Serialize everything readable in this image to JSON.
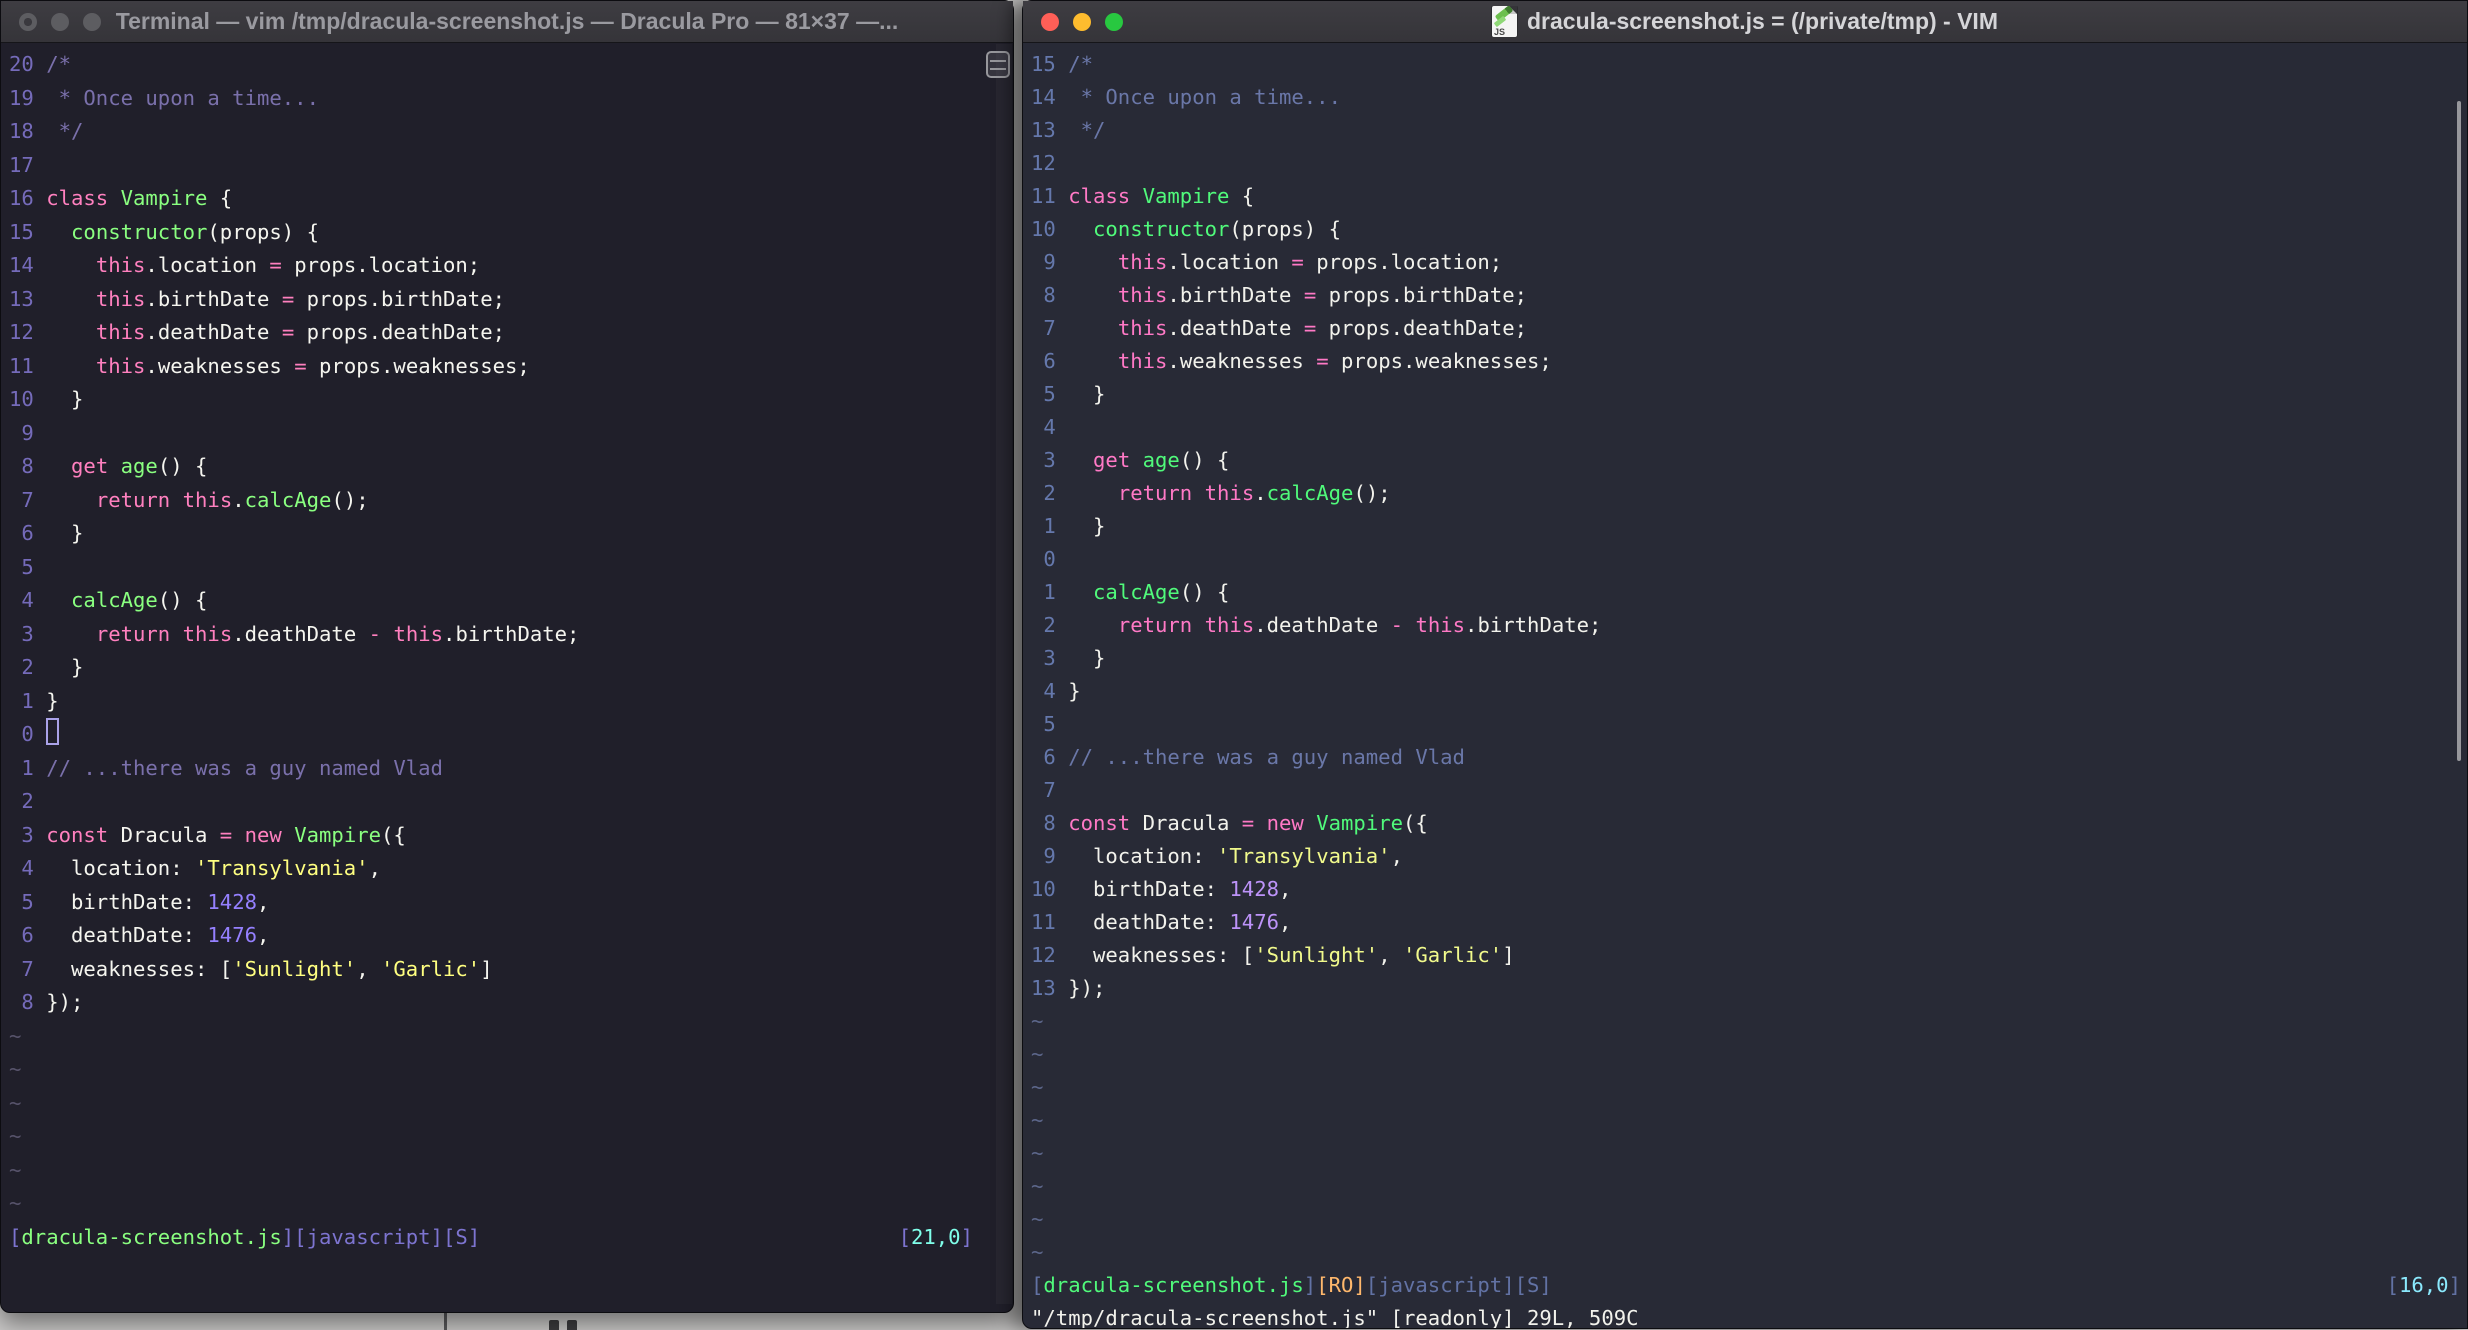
{
  "left_window": {
    "title": "Terminal — vim /tmp/dracula-screenshot.js — Dracula Pro — 81×37 —...",
    "numbers": [
      "20",
      "19",
      "18",
      "17",
      "16",
      "15",
      "14",
      "13",
      "12",
      "11",
      "10",
      "9",
      "8",
      "7",
      "6",
      "5",
      "4",
      "3",
      "2",
      "1",
      "0",
      "1",
      "2",
      "3",
      "4",
      "5",
      "6",
      "7",
      "8"
    ],
    "cursor_row": 20,
    "cursor_visible": true,
    "tilde_rows": 6,
    "statusline": [
      [
        "br",
        "["
      ],
      [
        "gr",
        "dracula-screenshot.js"
      ],
      [
        "br",
        "]["
      ],
      [
        "bl",
        "javascript"
      ],
      [
        "br",
        "]["
      ],
      [
        "bl",
        "S"
      ],
      [
        "br",
        "]"
      ]
    ],
    "ruler": [
      [
        "br",
        "["
      ],
      [
        "cy",
        "21,0"
      ],
      [
        "br",
        "]"
      ]
    ],
    "command_line": "",
    "palette": {
      "bg": "#201f2a",
      "fg": "#f5f5ef",
      "comment": "#7a70ab",
      "pink": "#ff80bf",
      "green": "#8aff80",
      "yellow": "#ffff80",
      "purple": "#9580ff",
      "cyan": "#80ffea",
      "orange": "#ffca80",
      "lnum": "#756bba",
      "bracket": "#7d74d0",
      "stat": "#7d74d0",
      "tilde": "#57536b"
    }
  },
  "right_window": {
    "title": "dracula-screenshot.js = (/private/tmp) - VIM",
    "file_icon": "js-file-icon",
    "numbers": [
      "15",
      "14",
      "13",
      "12",
      "11",
      "10",
      "9",
      "8",
      "7",
      "6",
      "5",
      "4",
      "3",
      "2",
      "1",
      "0",
      "1",
      "2",
      "3",
      "4",
      "5",
      "6",
      "7",
      "8",
      "9",
      "10",
      "11",
      "12",
      "13"
    ],
    "cursor_row": 15,
    "cursor_visible": false,
    "tilde_rows": 8,
    "statusline": [
      [
        "br",
        "["
      ],
      [
        "gr",
        "dracula-screenshot.js"
      ],
      [
        "br",
        "]"
      ],
      [
        "or",
        "[RO]"
      ],
      [
        "br",
        "["
      ],
      [
        "bl",
        "javascript"
      ],
      [
        "br",
        "]["
      ],
      [
        "bl",
        "S"
      ],
      [
        "br",
        "]"
      ]
    ],
    "ruler": [
      [
        "br",
        "["
      ],
      [
        "cy",
        "16,0"
      ],
      [
        "br",
        "]"
      ]
    ],
    "command_line": "\"/tmp/dracula-screenshot.js\" [readonly] 29L, 509C",
    "palette": {
      "bg": "#282a36",
      "fg": "#f2f2ec",
      "comment": "#6a77a8",
      "pink": "#ff79c6",
      "green": "#50fa7b",
      "yellow": "#f1fa8c",
      "purple": "#bd93f9",
      "cyan": "#8be9fd",
      "orange": "#ffb86c",
      "lnum": "#6578ac",
      "bracket": "#6272a4",
      "stat": "#6272a4",
      "tilde": "#5c668a"
    }
  },
  "code_lines": [
    [
      [
        "c",
        "/*"
      ]
    ],
    [
      [
        "c",
        " * Once upon a time..."
      ]
    ],
    [
      [
        "c",
        " */"
      ]
    ],
    [],
    [
      [
        "k",
        "class"
      ],
      [
        "w",
        " "
      ],
      [
        "f",
        "Vampire"
      ],
      [
        "w",
        " {"
      ]
    ],
    [
      [
        "w",
        "  "
      ],
      [
        "f",
        "constructor"
      ],
      [
        "w",
        "(props) {"
      ]
    ],
    [
      [
        "w",
        "    "
      ],
      [
        "k",
        "this"
      ],
      [
        "w",
        ".location "
      ],
      [
        "k",
        "="
      ],
      [
        "w",
        " props.location;"
      ]
    ],
    [
      [
        "w",
        "    "
      ],
      [
        "k",
        "this"
      ],
      [
        "w",
        ".birthDate "
      ],
      [
        "k",
        "="
      ],
      [
        "w",
        " props.birthDate;"
      ]
    ],
    [
      [
        "w",
        "    "
      ],
      [
        "k",
        "this"
      ],
      [
        "w",
        ".deathDate "
      ],
      [
        "k",
        "="
      ],
      [
        "w",
        " props.deathDate;"
      ]
    ],
    [
      [
        "w",
        "    "
      ],
      [
        "k",
        "this"
      ],
      [
        "w",
        ".weaknesses "
      ],
      [
        "k",
        "="
      ],
      [
        "w",
        " props.weaknesses;"
      ]
    ],
    [
      [
        "w",
        "  }"
      ]
    ],
    [],
    [
      [
        "w",
        "  "
      ],
      [
        "k",
        "get"
      ],
      [
        "w",
        " "
      ],
      [
        "f",
        "age"
      ],
      [
        "w",
        "() {"
      ]
    ],
    [
      [
        "w",
        "    "
      ],
      [
        "k",
        "return"
      ],
      [
        "w",
        " "
      ],
      [
        "k",
        "this"
      ],
      [
        "w",
        "."
      ],
      [
        "f",
        "calcAge"
      ],
      [
        "w",
        "();"
      ]
    ],
    [
      [
        "w",
        "  }"
      ]
    ],
    [],
    [
      [
        "w",
        "  "
      ],
      [
        "f",
        "calcAge"
      ],
      [
        "w",
        "() {"
      ]
    ],
    [
      [
        "w",
        "    "
      ],
      [
        "k",
        "return"
      ],
      [
        "w",
        " "
      ],
      [
        "k",
        "this"
      ],
      [
        "w",
        ".deathDate "
      ],
      [
        "k",
        "-"
      ],
      [
        "w",
        " "
      ],
      [
        "k",
        "this"
      ],
      [
        "w",
        ".birthDate;"
      ]
    ],
    [
      [
        "w",
        "  }"
      ]
    ],
    [
      [
        "w",
        "}"
      ]
    ],
    [],
    [
      [
        "c",
        "// ...there was a guy named Vlad"
      ]
    ],
    [],
    [
      [
        "k",
        "const"
      ],
      [
        "w",
        " Dracula "
      ],
      [
        "k",
        "="
      ],
      [
        "w",
        " "
      ],
      [
        "k",
        "new"
      ],
      [
        "w",
        " "
      ],
      [
        "f",
        "Vampire"
      ],
      [
        "w",
        "({"
      ]
    ],
    [
      [
        "w",
        "  location: "
      ],
      [
        "s",
        "'Transylvania'"
      ],
      [
        "w",
        ","
      ]
    ],
    [
      [
        "w",
        "  birthDate: "
      ],
      [
        "n",
        "1428"
      ],
      [
        "w",
        ","
      ]
    ],
    [
      [
        "w",
        "  deathDate: "
      ],
      [
        "n",
        "1476"
      ],
      [
        "w",
        ","
      ]
    ],
    [
      [
        "w",
        "  weaknesses: ["
      ],
      [
        "s",
        "'Sunlight'"
      ],
      [
        "w",
        ", "
      ],
      [
        "s",
        "'Garlic'"
      ],
      [
        "w",
        "]"
      ]
    ],
    [
      [
        "w",
        "});"
      ]
    ]
  ]
}
